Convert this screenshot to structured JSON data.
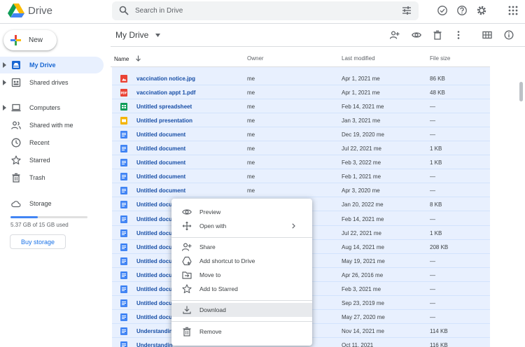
{
  "app": {
    "title": "Drive"
  },
  "search": {
    "placeholder": "Search in Drive"
  },
  "sidebar": {
    "new_label": "New",
    "items": [
      {
        "label": "My Drive",
        "active": true
      },
      {
        "label": "Shared drives"
      },
      {
        "label": "Computers"
      },
      {
        "label": "Shared with me"
      },
      {
        "label": "Recent"
      },
      {
        "label": "Starred"
      },
      {
        "label": "Trash"
      }
    ],
    "storage": {
      "label": "Storage",
      "usage_text": "5.37 GB of 15 GB used",
      "used_fraction": 0.358,
      "buy_label": "Buy storage"
    }
  },
  "main": {
    "breadcrumb": "My Drive",
    "columns": {
      "name": "Name",
      "owner": "Owner",
      "modified": "Last modified",
      "size": "File size"
    }
  },
  "files": [
    {
      "name": "vaccination notice.jpg",
      "type": "image",
      "owner": "me",
      "modified": "Apr 1, 2021 me",
      "size": "86 KB"
    },
    {
      "name": "vaccination appt 1.pdf",
      "type": "pdf",
      "owner": "me",
      "modified": "Apr 1, 2021 me",
      "size": "48 KB"
    },
    {
      "name": "Untitled spreadsheet",
      "type": "sheet",
      "owner": "me",
      "modified": "Feb 14, 2021 me",
      "size": "—"
    },
    {
      "name": "Untitled presentation",
      "type": "slides",
      "owner": "me",
      "modified": "Jan 3, 2021 me",
      "size": "—"
    },
    {
      "name": "Untitled document",
      "type": "doc",
      "owner": "me",
      "modified": "Dec 19, 2020 me",
      "size": "—"
    },
    {
      "name": "Untitled document",
      "type": "doc",
      "owner": "me",
      "modified": "Jul 22, 2021 me",
      "size": "1 KB"
    },
    {
      "name": "Untitled document",
      "type": "doc",
      "owner": "me",
      "modified": "Feb 3, 2022 me",
      "size": "1 KB"
    },
    {
      "name": "Untitled document",
      "type": "doc",
      "owner": "me",
      "modified": "Feb 1, 2021 me",
      "size": "—"
    },
    {
      "name": "Untitled document",
      "type": "doc",
      "owner": "me",
      "modified": "Apr 3, 2020 me",
      "size": "—"
    },
    {
      "name": "Untitled docu",
      "type": "doc",
      "owner": "",
      "modified": "Jan 20, 2022 me",
      "size": "8 KB"
    },
    {
      "name": "Untitled docu",
      "type": "doc",
      "owner": "",
      "modified": "Feb 14, 2021 me",
      "size": "—"
    },
    {
      "name": "Untitled docu",
      "type": "doc",
      "owner": "",
      "modified": "Jul 22, 2021 me",
      "size": "1 KB"
    },
    {
      "name": "Untitled docu",
      "type": "doc",
      "owner": "",
      "modified": "Aug 14, 2021 me",
      "size": "208 KB"
    },
    {
      "name": "Untitled docu",
      "type": "doc",
      "owner": "",
      "modified": "May 19, 2021 me",
      "size": "—"
    },
    {
      "name": "Untitled docu",
      "type": "doc",
      "owner": "",
      "modified": "Apr 26, 2016 me",
      "size": "—"
    },
    {
      "name": "Untitled docu",
      "type": "doc",
      "owner": "",
      "modified": "Feb 3, 2021 me",
      "size": "—"
    },
    {
      "name": "Untitled docu",
      "type": "doc",
      "owner": "",
      "modified": "Sep 23, 2019 me",
      "size": "—"
    },
    {
      "name": "Untitled docu",
      "type": "doc",
      "owner": "",
      "modified": "May 27, 2020 me",
      "size": "—"
    },
    {
      "name": "Understandin",
      "type": "doc",
      "owner": "",
      "modified": "Nov 14, 2021 me",
      "size": "114 KB"
    },
    {
      "name": "Understandin",
      "type": "doc",
      "owner": "",
      "modified": "Oct 11, 2021",
      "size": "116 KB"
    }
  ],
  "context_menu": {
    "items": [
      {
        "label": "Preview",
        "icon": "eye-icon"
      },
      {
        "label": "Open with",
        "icon": "move-arrows-icon",
        "submenu": true
      },
      {
        "label": "Share",
        "icon": "person-add-icon"
      },
      {
        "label": "Add shortcut to Drive",
        "icon": "drive-shortcut-icon"
      },
      {
        "label": "Move to",
        "icon": "folder-move-icon"
      },
      {
        "label": "Add to Starred",
        "icon": "star-icon"
      },
      {
        "label": "Download",
        "icon": "download-icon",
        "hover": true
      },
      {
        "label": "Remove",
        "icon": "trash-icon"
      }
    ]
  },
  "colors": {
    "accent": "#1a73e8",
    "selection": "#e8f0fe",
    "file_name": "#174ea6",
    "doc": "#4285f4",
    "sheet": "#0f9d58",
    "slides": "#f4b400",
    "pdf": "#ea4335"
  }
}
